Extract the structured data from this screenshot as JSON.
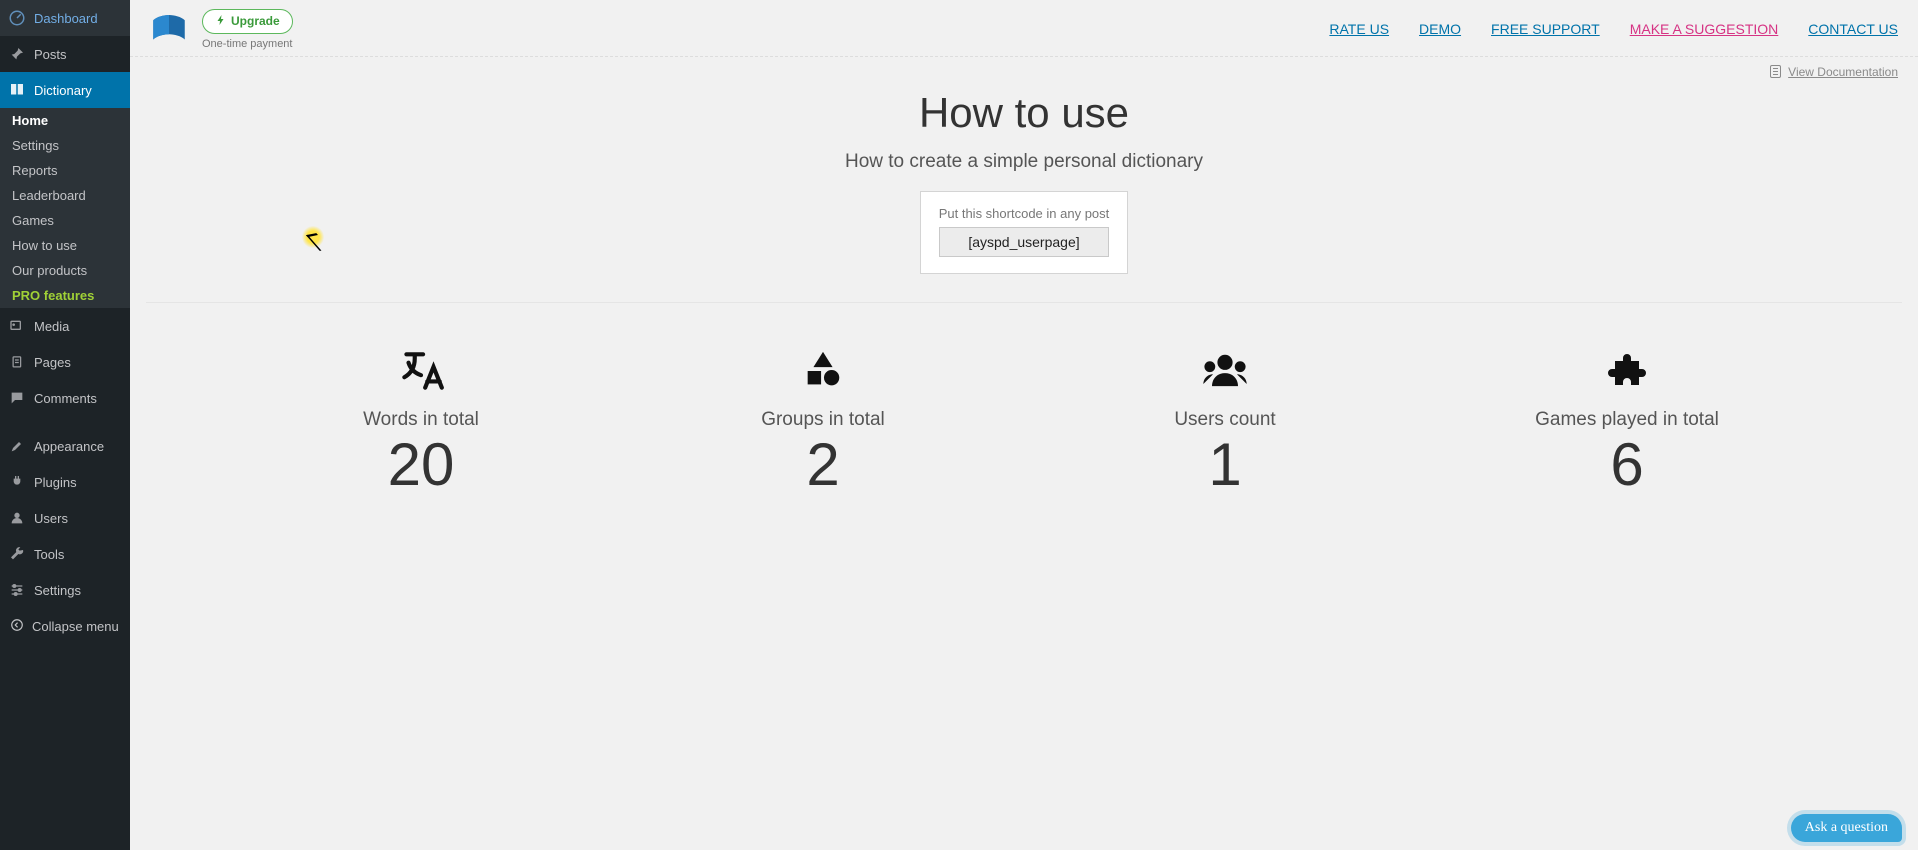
{
  "sidebar": {
    "dashboard": "Dashboard",
    "posts": "Posts",
    "dictionary": "Dictionary",
    "sub": {
      "home": "Home",
      "settings": "Settings",
      "reports": "Reports",
      "leaderboard": "Leaderboard",
      "games": "Games",
      "howto": "How to use",
      "products": "Our products",
      "pro": "PRO features"
    },
    "media": "Media",
    "pages": "Pages",
    "comments": "Comments",
    "appearance": "Appearance",
    "plugins": "Plugins",
    "users": "Users",
    "tools": "Tools",
    "settings2": "Settings",
    "collapse": "Collapse menu"
  },
  "header": {
    "upgrade": "Upgrade",
    "onetime": "One-time payment",
    "nav": {
      "rate": "RATE US",
      "demo": "DEMO",
      "support": "FREE SUPPORT",
      "suggest": "MAKE A SUGGESTION",
      "contact": "CONTACT US"
    },
    "viewdoc": "View Documentation"
  },
  "hero": {
    "title": "How to use",
    "sub": "How to create a simple personal dictionary",
    "shortcode_label": "Put this shortcode in any post",
    "shortcode": "[ayspd_userpage]"
  },
  "stats": {
    "words": {
      "label": "Words in total",
      "value": "20"
    },
    "groups": {
      "label": "Groups in total",
      "value": "2"
    },
    "users": {
      "label": "Users count",
      "value": "1"
    },
    "games": {
      "label": "Games played in total",
      "value": "6"
    }
  },
  "askq": "Ask a\nquestion"
}
